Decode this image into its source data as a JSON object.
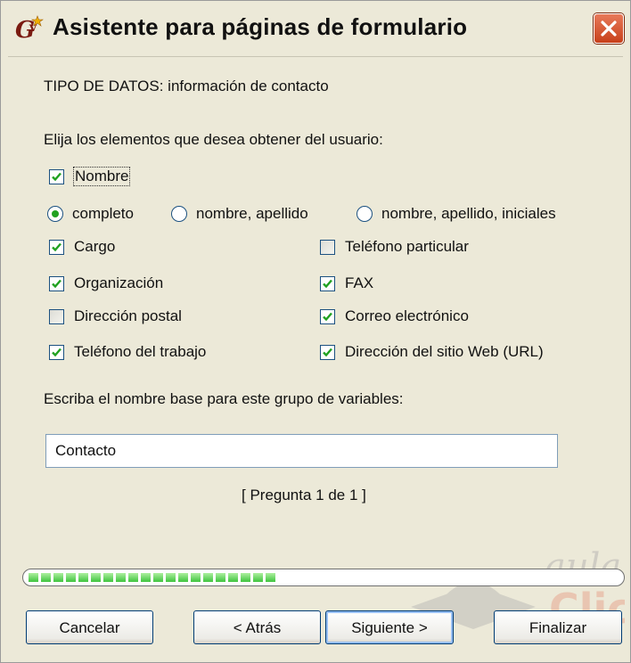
{
  "window": {
    "title": "Asistente para páginas de formulario"
  },
  "header_text": "TIPO DE DATOS: información de contacto",
  "instruction": "Elija los elementos que desea obtener del usuario:",
  "nombre": {
    "label": "Nombre",
    "checked": true
  },
  "name_format": [
    {
      "label": "completo",
      "selected": true
    },
    {
      "label": "nombre, apellido",
      "selected": false
    },
    {
      "label": "nombre, apellido, iniciales",
      "selected": false
    }
  ],
  "fields_left": [
    {
      "label": "Cargo",
      "checked": true
    },
    {
      "label": "Organización",
      "checked": true
    },
    {
      "label": "Dirección postal",
      "checked": false
    },
    {
      "label": "Teléfono del trabajo",
      "checked": true
    }
  ],
  "fields_right": [
    {
      "label": "Teléfono particular",
      "checked": false
    },
    {
      "label": "FAX",
      "checked": true
    },
    {
      "label": "Correo electrónico",
      "checked": true
    },
    {
      "label": "Dirección del sitio Web (URL)",
      "checked": true
    }
  ],
  "base_name_label": "Escriba el nombre base para este grupo de variables:",
  "base_name_value": "Contacto",
  "question_counter": "[ Pregunta 1 de 1 ]",
  "progress_fraction": 0.43,
  "watermark_text": "aula Clic",
  "buttons": {
    "cancel": "Cancelar",
    "back": "< Atrás",
    "next": "Siguiente >",
    "finish": "Finalizar"
  },
  "colors": {
    "window_bg": "#ECE9D8",
    "check_green": "#21a121",
    "progress_green": "#3ec43e",
    "close_red": "#c8401a"
  }
}
